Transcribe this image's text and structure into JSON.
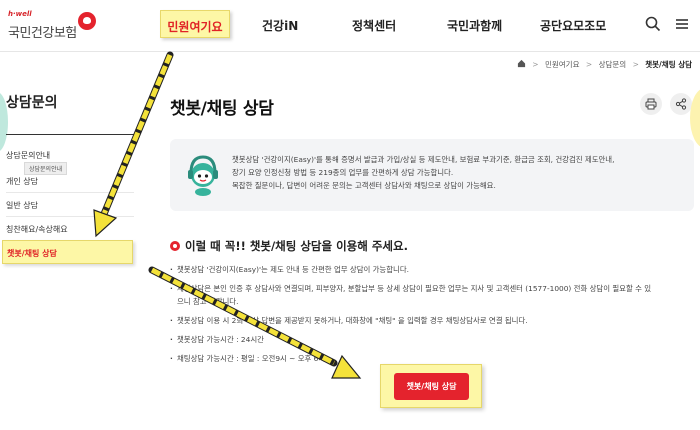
{
  "logo": {
    "small": "h·well",
    "main": "국민건강보험"
  },
  "gnb": [
    {
      "label": "민원여기요"
    },
    {
      "label": "건강iN"
    },
    {
      "label": "정책센터"
    },
    {
      "label": "국민과함께"
    },
    {
      "label": "공단요모조모"
    }
  ],
  "header_icons": [
    "search-icon",
    "menu-icon"
  ],
  "breadcrumb": {
    "items": [
      "민원여기요",
      "상담문의"
    ],
    "current": "챗봇/채팅 상담"
  },
  "sidebar": {
    "title": "상담문의",
    "items": [
      {
        "label": "상담문의안내"
      },
      {
        "label": "개인 상담"
      },
      {
        "label": "일반 상담"
      },
      {
        "label": "칭찬해요/속상해요"
      },
      {
        "label": "챗봇/채팅 상담"
      }
    ],
    "tooltip": "상담문의안내",
    "active_index": 4
  },
  "main": {
    "title": "챗봇/채팅 상담",
    "intro_lines": [
      "챗봇상담 '건강이지(Easy)'를 통해 증명서 발급과 가입/상실 등 제도안내, 보험료 부과기준, 환급금 조회, 건강검진 제도안내,",
      "장기 요양 인정신청 방법 등 219종의 업무를 간편하게 상담 가능합니다.",
      "복잡한 질문이나, 답변이 어려운 문의는 고객센터 상담사와 채팅으로 상담이 가능해요."
    ],
    "section_title": "이럴 때 꼭!! 챗봇/채팅 상담을 이용해 주세요.",
    "bullets": [
      "챗봇상담 '건강이지(Easy)'는 제도 안내 등 간편한 업무 상담이 가능합니다.",
      "채팅상담은 본인 인증 후 상담사와 연결되며, 피부양자, 분할납부 등 상세 상담이 필요한 업무는 지사 및 고객센터 (1577-1000) 전화 상담이 필요할 수 있",
      "으니 참고 바랍니다.",
      "챗봇상담 이용 시 2회 이상 답변을 제공받지 못하거나, 대화창에 \"채팅\" 을 입력할 경우 채팅상담사로 연결 됩니다.",
      "챗봇상담 가능시간 : 24시간",
      "채팅상담 가능시간 : 평일 : 오전9시 ~ 오후 6시"
    ],
    "cta_label": "챗봇/채팅 상담"
  },
  "colors": {
    "brand_red": "#e4232d",
    "highlight_yellow": "#fdf7a6"
  }
}
